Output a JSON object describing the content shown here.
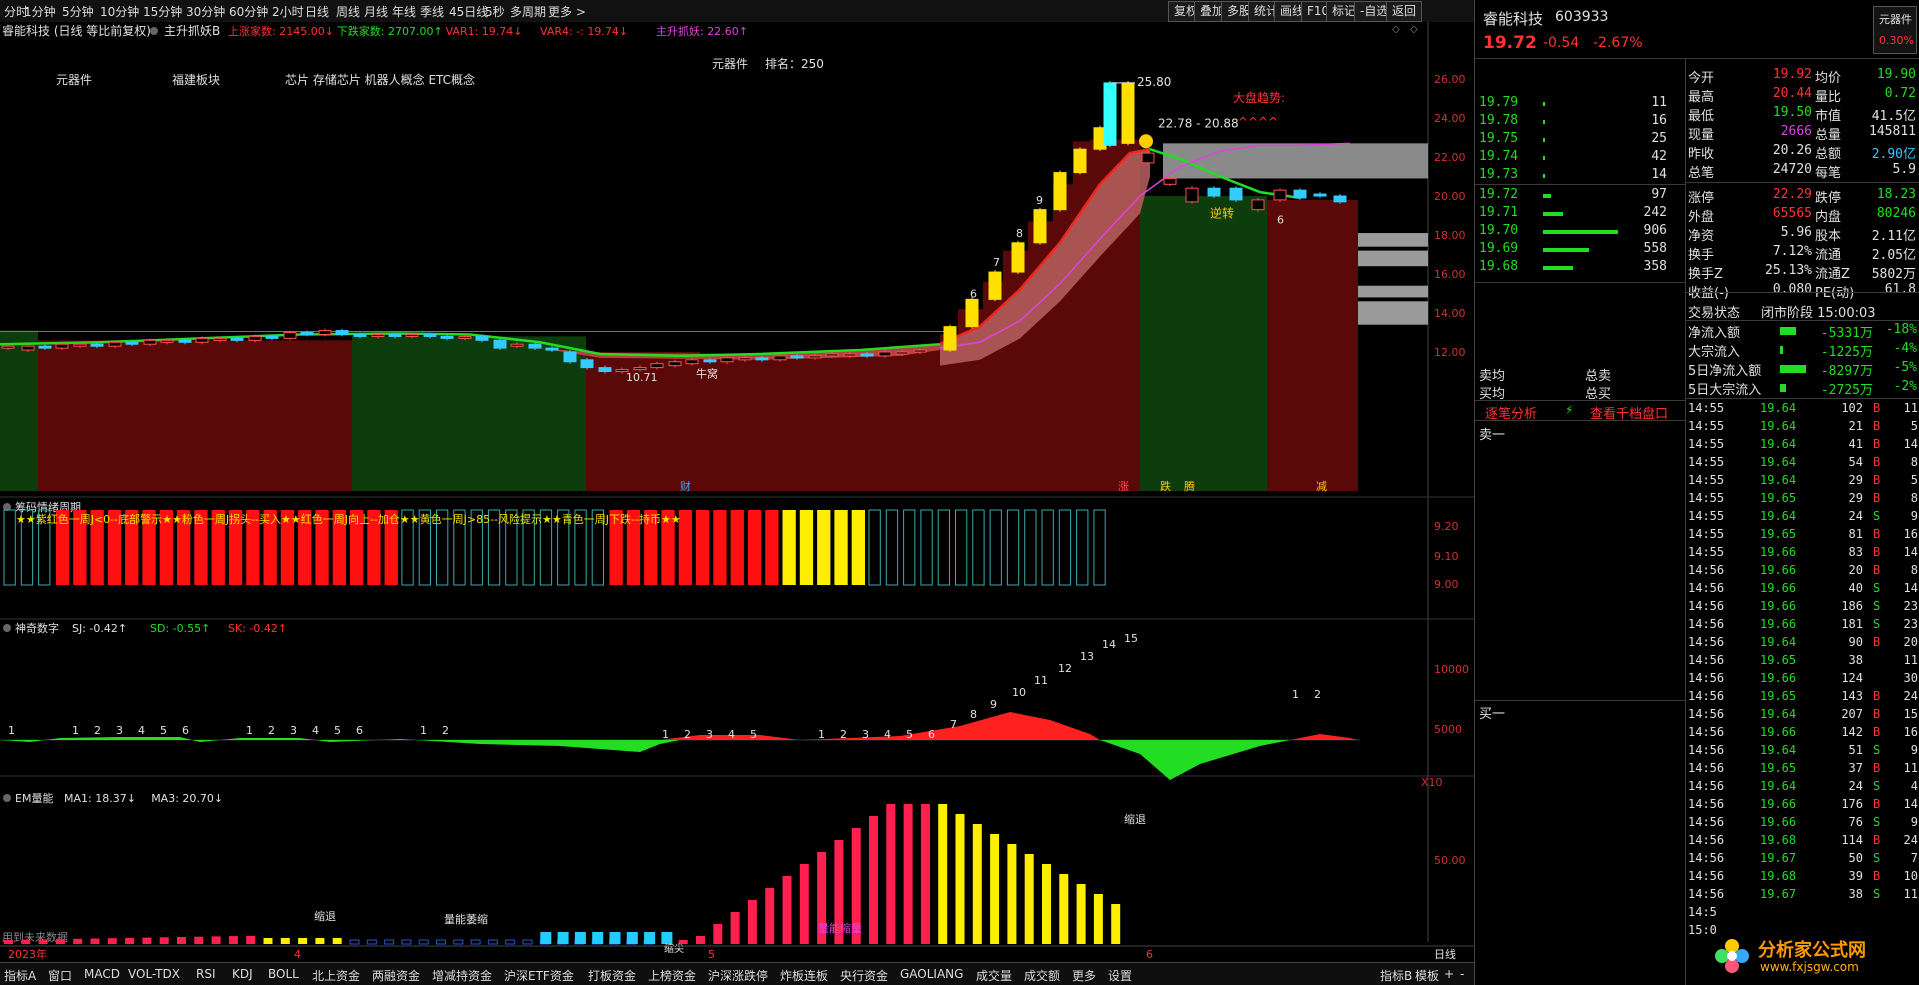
{
  "toolbar": {
    "periods": [
      "分时",
      "1分钟",
      "5分钟",
      "10分钟",
      "15分钟",
      "30分钟",
      "60分钟",
      "2小时",
      "日线",
      "周线",
      "月线",
      "年线",
      "季线",
      "45日线",
      "5秒",
      "多周期",
      "更多 >"
    ],
    "buttons": [
      "复权",
      "叠加",
      "多股",
      "统计",
      "画线",
      "F10",
      "标记",
      "-自选",
      "返回"
    ]
  },
  "main_chart": {
    "header": "睿能科技 (日线 等比前复权)",
    "indicator_name": "主升抓妖B",
    "indicator_values": [
      {
        "text": "上涨家数: 2145.00↓",
        "color": "#ff3333"
      },
      {
        "text": "下跌家数: 2707.00↑",
        "color": "#22dd22"
      },
      {
        "text": "VAR1: 19.74↓",
        "color": "#ff3333"
      },
      {
        "text": "VAR4: -: 19.74↓",
        "color": "#ff3333"
      },
      {
        "text": "主升抓妖: 22.60↑",
        "color": "#dd44dd"
      }
    ],
    "tags": {
      "t1": "元器件",
      "t2": "福建板块",
      "t3": "芯片 存储芯片 机器人概念 ETC概念",
      "t4": "元器件",
      "t5": "排名：250"
    },
    "market_trend": "大盘趋势:",
    "market_marks": "^^^^",
    "high_label": "25.80",
    "range_label": "22.78 - 20.88",
    "low_label": "10.71",
    "niu_label": "牛窝",
    "reverse_label": "逆转",
    "count_labels": [
      "6",
      "7",
      "8",
      "9",
      "6"
    ],
    "bottom_tags": {
      "cai": "财",
      "zhang": "涨",
      "die": "跌",
      "teng": "腾",
      "jian": "减"
    },
    "y_ticks": [
      "26.00",
      "24.00",
      "22.00",
      "20.00",
      "18.00",
      "16.00",
      "14.00",
      "12.00"
    ]
  },
  "panel2": {
    "title": "筹码情绪周期",
    "legend": "★★紫红色一周J<0--底部警示★★粉色一周J拐头--买入★★红色一周J向上--加仓★★黄色一周J>85--风险提示★★青色一周J下跌--持币★★",
    "y_ticks": [
      "9.20",
      "9.10",
      "9.00"
    ]
  },
  "panel3": {
    "title": "神奇数字",
    "values": [
      {
        "text": "SJ: -0.42↑",
        "color": "#e0e0e0"
      },
      {
        "text": "SD: -0.55↑",
        "color": "#22dd22"
      },
      {
        "text": "SK: -0.42↑",
        "color": "#ff3333"
      }
    ],
    "numbers": [
      "1",
      "1",
      "2",
      "3",
      "4",
      "5",
      "6",
      "1",
      "2",
      "3",
      "4",
      "5",
      "6",
      "1",
      "2",
      "1",
      "2",
      "3",
      "4",
      "5",
      "1",
      "2",
      "3",
      "4",
      "5",
      "6",
      "7",
      "8",
      "9",
      "10",
      "11",
      "12",
      "13",
      "14",
      "15",
      "1",
      "2"
    ],
    "y_ticks": [
      "10000",
      "5000"
    ],
    "scale": "X10"
  },
  "panel4": {
    "title": "EM量能",
    "values": [
      {
        "text": "MA1: 18.37↓",
        "color": "#e0e0e0"
      },
      {
        "text": "MA3: 20.70↓",
        "color": "#e0e0e0"
      }
    ],
    "future_data": "用到未来数据",
    "labels": {
      "shrink1": "缩退",
      "energy": "量能萎缩",
      "energy2": "量能缩量",
      "shrink2": "缩退",
      "bottom": "缩尖"
    },
    "y_tick": "50.00"
  },
  "date_axis": {
    "year": "2023年",
    "m4": "4",
    "m5": "5",
    "m6": "6",
    "mode": "日线"
  },
  "bottom_tabs": [
    "指标A",
    "窗口",
    "MACD",
    "VOL-TDX",
    "RSI",
    "KDJ",
    "BOLL",
    "北上资金",
    "两融资金",
    "增减持资金",
    "沪深ETF资金",
    "打板资金",
    "上榜资金",
    "沪深涨跌停",
    "炸板连板",
    "央行资金",
    "GAOLIANG",
    "成交量",
    "成交额",
    "更多",
    "设置"
  ],
  "bottom_right": {
    "b1": "指标B",
    "b2": "模板",
    "b3": "+",
    "b4": "-"
  },
  "quote": {
    "name": "睿能科技",
    "code": "603933",
    "sector_btn": "元器件",
    "price": "19.72",
    "change": "-0.54",
    "pct": "-2.67%",
    "sector_pct": "0.30%",
    "sells": [
      {
        "p": "19.79",
        "v": "11",
        "w": 2
      },
      {
        "p": "19.78",
        "v": "16",
        "w": 2
      },
      {
        "p": "19.75",
        "v": "25",
        "w": 2
      },
      {
        "p": "19.74",
        "v": "42",
        "w": 2
      },
      {
        "p": "19.73",
        "v": "14",
        "w": 2
      }
    ],
    "buys": [
      {
        "p": "19.72",
        "v": "97",
        "w": 8
      },
      {
        "p": "19.71",
        "v": "242",
        "w": 20
      },
      {
        "p": "19.70",
        "v": "906",
        "w": 75
      },
      {
        "p": "19.69",
        "v": "558",
        "w": 46
      },
      {
        "p": "19.68",
        "v": "358",
        "w": 30
      }
    ],
    "sell_avg": "卖均",
    "sell_total": "总卖",
    "buy_avg": "买均",
    "buy_total": "总买",
    "tab_analysis": "逐笔分析",
    "tab_qiandang": "查看千档盘口",
    "sell1": "卖一",
    "buy1": "买一",
    "stats": [
      {
        "l": "今开",
        "v": "19.92",
        "vc": "#ff3333",
        "l2": "均价",
        "v2": "19.90",
        "v2c": "#22dd22"
      },
      {
        "l": "最高",
        "v": "20.44",
        "vc": "#ff3333",
        "l2": "量比",
        "v2": "0.72",
        "v2c": "#22dd22"
      },
      {
        "l": "最低",
        "v": "19.50",
        "vc": "#22dd22",
        "l2": "市值",
        "v2": "41.5亿",
        "v2c": "#e0e0e0"
      },
      {
        "l": "现量",
        "v": "2666",
        "vc": "#dd44dd",
        "l2": "总量",
        "v2": "145811",
        "v2c": "#e0e0e0"
      },
      {
        "l": "昨收",
        "v": "20.26",
        "vc": "#e0e0e0",
        "l2": "总额",
        "v2": "2.90亿",
        "v2c": "#33ccff"
      },
      {
        "l": "总笔",
        "v": "24720",
        "vc": "#e0e0e0",
        "l2": "每笔",
        "v2": "5.9",
        "v2c": "#e0e0e0"
      },
      {
        "l": "涨停",
        "v": "22.29",
        "vc": "#ff3333",
        "l2": "跌停",
        "v2": "18.23",
        "v2c": "#22dd22"
      },
      {
        "l": "外盘",
        "v": "65565",
        "vc": "#ff3333",
        "l2": "内盘",
        "v2": "80246",
        "v2c": "#22dd22"
      },
      {
        "l": "净资",
        "v": "5.96",
        "vc": "#e0e0e0",
        "l2": "股本",
        "v2": "2.11亿",
        "v2c": "#e0e0e0"
      },
      {
        "l": "换手",
        "v": "7.12%",
        "vc": "#e0e0e0",
        "l2": "流通",
        "v2": "2.05亿",
        "v2c": "#e0e0e0"
      },
      {
        "l": "换手Z",
        "v": "25.13%",
        "vc": "#e0e0e0",
        "l2": "流通Z",
        "v2": "5802万",
        "v2c": "#e0e0e0"
      },
      {
        "l": "收益(-)",
        "v": "0.080",
        "vc": "#e0e0e0",
        "l2": "PE(动)",
        "v2": "61.8",
        "v2c": "#e0e0e0"
      }
    ],
    "trade_status_l": "交易状态",
    "trade_status_v": "闭市阶段 15:00:03",
    "flows": [
      {
        "l": "净流入额",
        "v": "-5331万",
        "p": "-18%",
        "w": 16
      },
      {
        "l": "大宗流入",
        "v": "-1225万",
        "p": "-4%",
        "w": 3
      },
      {
        "l": "5日净流入额",
        "v": "-8297万",
        "p": "-5%",
        "w": 26
      },
      {
        "l": "5日大宗流入",
        "v": "-2725万",
        "p": "-2%",
        "w": 6
      }
    ],
    "ticks": [
      {
        "t": "14:55",
        "p": "19.64",
        "v": "102",
        "d": "B",
        "n": "11"
      },
      {
        "t": "14:55",
        "p": "19.64",
        "v": "21",
        "d": "B",
        "n": "5"
      },
      {
        "t": "14:55",
        "p": "19.64",
        "v": "41",
        "d": "B",
        "n": "14"
      },
      {
        "t": "14:55",
        "p": "19.64",
        "v": "54",
        "d": "B",
        "n": "8"
      },
      {
        "t": "14:55",
        "p": "19.64",
        "v": "29",
        "d": "B",
        "n": "5"
      },
      {
        "t": "14:55",
        "p": "19.65",
        "v": "29",
        "d": "B",
        "n": "8"
      },
      {
        "t": "14:55",
        "p": "19.64",
        "v": "24",
        "d": "S",
        "n": "9"
      },
      {
        "t": "14:55",
        "p": "19.65",
        "v": "81",
        "d": "B",
        "n": "16"
      },
      {
        "t": "14:55",
        "p": "19.66",
        "v": "83",
        "d": "B",
        "n": "14"
      },
      {
        "t": "14:56",
        "p": "19.66",
        "v": "20",
        "d": "B",
        "n": "8"
      },
      {
        "t": "14:56",
        "p": "19.66",
        "v": "40",
        "d": "S",
        "n": "14"
      },
      {
        "t": "14:56",
        "p": "19.66",
        "v": "186",
        "d": "S",
        "n": "23"
      },
      {
        "t": "14:56",
        "p": "19.66",
        "v": "181",
        "d": "S",
        "n": "23"
      },
      {
        "t": "14:56",
        "p": "19.64",
        "v": "90",
        "d": "B",
        "n": "20"
      },
      {
        "t": "14:56",
        "p": "19.65",
        "v": "38",
        "d": "",
        "n": "11"
      },
      {
        "t": "14:56",
        "p": "19.66",
        "v": "124",
        "d": "",
        "n": "30"
      },
      {
        "t": "14:56",
        "p": "19.65",
        "v": "143",
        "d": "B",
        "n": "24"
      },
      {
        "t": "14:56",
        "p": "19.64",
        "v": "207",
        "d": "B",
        "n": "15"
      },
      {
        "t": "14:56",
        "p": "19.66",
        "v": "142",
        "d": "B",
        "n": "16"
      },
      {
        "t": "14:56",
        "p": "19.64",
        "v": "51",
        "d": "S",
        "n": "9"
      },
      {
        "t": "14:56",
        "p": "19.65",
        "v": "37",
        "d": "B",
        "n": "11"
      },
      {
        "t": "14:56",
        "p": "19.64",
        "v": "24",
        "d": "S",
        "n": "4"
      },
      {
        "t": "14:56",
        "p": "19.66",
        "v": "176",
        "d": "B",
        "n": "14"
      },
      {
        "t": "14:56",
        "p": "19.66",
        "v": "76",
        "d": "S",
        "n": "9"
      },
      {
        "t": "14:56",
        "p": "19.68",
        "v": "114",
        "d": "B",
        "n": "24"
      },
      {
        "t": "14:56",
        "p": "19.67",
        "v": "50",
        "d": "S",
        "n": "7"
      },
      {
        "t": "14:56",
        "p": "19.68",
        "v": "39",
        "d": "B",
        "n": "10"
      },
      {
        "t": "14:56",
        "p": "19.67",
        "v": "38",
        "d": "S",
        "n": "11"
      },
      {
        "t": "14:5",
        "p": "",
        "v": "",
        "d": "",
        "n": ""
      },
      {
        "t": "15:0",
        "p": "",
        "v": "",
        "d": "",
        "n": ""
      }
    ]
  },
  "watermark": {
    "title": "分析家公式网",
    "url": "www.fxjsgw.com"
  }
}
